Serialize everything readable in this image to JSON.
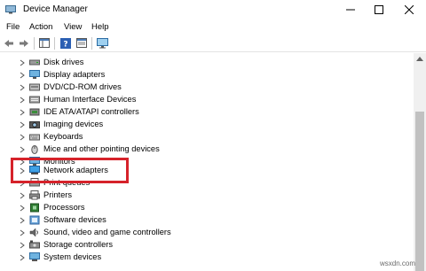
{
  "window": {
    "title": "Device Manager"
  },
  "menu": [
    "File",
    "Action",
    "View",
    "Help"
  ],
  "devices": [
    {
      "label": "Disk drives",
      "icon": "disk-drive-icon"
    },
    {
      "label": "Display adapters",
      "icon": "display-adapter-icon"
    },
    {
      "label": "DVD/CD-ROM drives",
      "icon": "dvd-drive-icon"
    },
    {
      "label": "Human Interface Devices",
      "icon": "hid-icon"
    },
    {
      "label": "IDE ATA/ATAPI controllers",
      "icon": "ide-controller-icon"
    },
    {
      "label": "Imaging devices",
      "icon": "camera-icon"
    },
    {
      "label": "Keyboards",
      "icon": "keyboard-icon"
    },
    {
      "label": "Mice and other pointing devices",
      "icon": "mouse-icon"
    },
    {
      "label": "Monitors",
      "icon": "monitor-icon"
    },
    {
      "label": "Network adapters",
      "icon": "network-adapter-icon"
    },
    {
      "label": "Print queues",
      "icon": "print-queue-icon"
    },
    {
      "label": "Printers",
      "icon": "printer-icon"
    },
    {
      "label": "Processors",
      "icon": "processor-icon"
    },
    {
      "label": "Software devices",
      "icon": "software-device-icon"
    },
    {
      "label": "Sound, video and game controllers",
      "icon": "sound-icon"
    },
    {
      "label": "Storage controllers",
      "icon": "storage-controller-icon"
    },
    {
      "label": "System devices",
      "icon": "system-device-icon"
    }
  ],
  "highlight_color": "#d6222a",
  "watermark": "wsxdn.com"
}
